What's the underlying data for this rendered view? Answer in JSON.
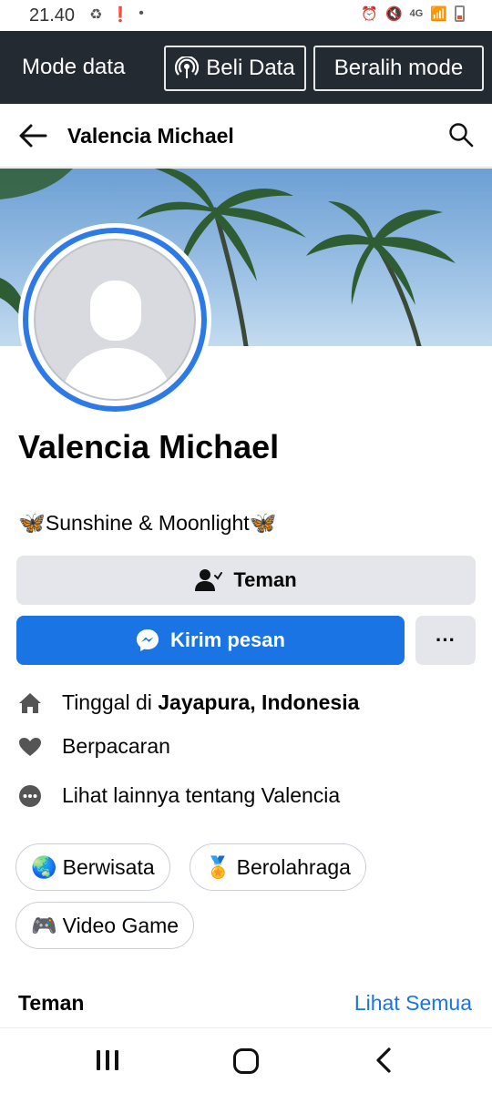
{
  "status_bar": {
    "time": "21.40",
    "network": "4G"
  },
  "data_bar": {
    "label": "Mode data",
    "buy_label": "Beli Data",
    "switch_label": "Beralih mode"
  },
  "header": {
    "title": "Valencia Michael"
  },
  "profile": {
    "name": "Valencia Michael",
    "bio": "Sunshine & Moonlight",
    "friend_button": "Teman",
    "message_button": "Kirim pesan",
    "more_button": "···"
  },
  "info": {
    "lives_prefix": "Tinggal di ",
    "lives_place": "Jayapura, Indonesia",
    "relationship": "Berpacaran",
    "see_more": "Lihat lainnya tentang Valencia"
  },
  "hobbies": [
    {
      "emoji": "🌏",
      "label": "Berwisata"
    },
    {
      "emoji": "🏅",
      "label": "Berolahraga"
    },
    {
      "emoji": "🎮",
      "label": "Video Game"
    }
  ],
  "friends": {
    "title": "Teman",
    "see_all": "Lihat Semua"
  },
  "colors": {
    "accent": "#1b74e4",
    "dark_bar": "#242a31",
    "avatar_ring": "#2d7ae6"
  }
}
